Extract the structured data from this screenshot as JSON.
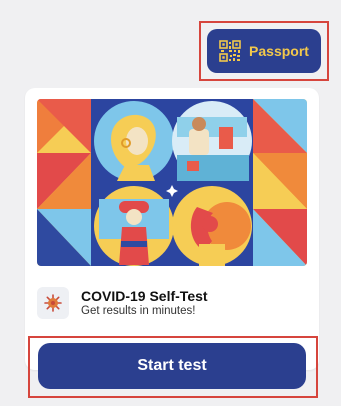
{
  "header": {
    "passport_label": "Passport",
    "passport_icon": "qr-code-icon"
  },
  "card": {
    "illustration": "covid-test-illustration",
    "test_icon": "virus-icon",
    "test_title": "COVID-19 Self-Test",
    "test_subtitle": "Get results in minutes!"
  },
  "actions": {
    "start_label": "Start test"
  },
  "colors": {
    "primary": "#2b3f8f",
    "accent_yellow": "#f2c84b",
    "highlight_red": "#d6453d",
    "background": "#f0f0f2"
  }
}
